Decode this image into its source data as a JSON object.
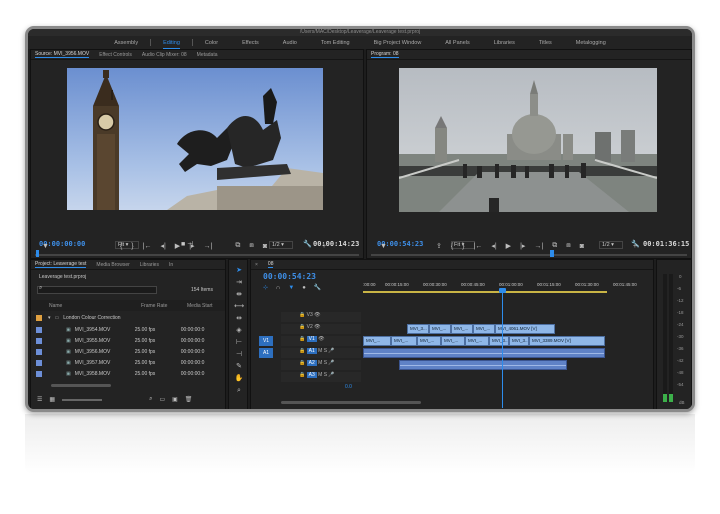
{
  "window": {
    "title": "/Users/MAC/Desktop/Leaverage/Leaverage test.prproj"
  },
  "workspaces": [
    "Assembly",
    "Editing",
    "Color",
    "Effects",
    "Audio",
    "Tom Editing",
    "Big Project Window",
    "All Panels",
    "Libraries",
    "Titles",
    "Metalogging"
  ],
  "active_workspace": "Editing",
  "source": {
    "tabs": [
      "Source: MVI_3956.MOV",
      "Effect Controls",
      "Audio Clip Mixer: 08",
      "Metadata"
    ],
    "timecode": "00:00:00:00",
    "fit": "Fit",
    "resolution": "1/2",
    "duration": "00:00:14:23"
  },
  "program": {
    "tab": "Program: 08",
    "timecode": "00:00:54:23",
    "fit": "Fit",
    "resolution": "1/2",
    "duration": "00:01:36:15"
  },
  "project": {
    "tabs": [
      "Project: Leaverage test",
      "Media Browser",
      "Libraries",
      "In"
    ],
    "file": "Leaverage test.prproj",
    "count": "154 Items",
    "columns": [
      "Name",
      "Frame Rate",
      "Media Start"
    ],
    "folder": "London Colour Correction",
    "items": [
      {
        "name": "MVI_3954.MOV",
        "fps": "25.00 fps",
        "start": "00:00:00:0"
      },
      {
        "name": "MVI_3955.MOV",
        "fps": "25.00 fps",
        "start": "00:00:00:0"
      },
      {
        "name": "MVI_3956.MOV",
        "fps": "25.00 fps",
        "start": "00:00:00:0"
      },
      {
        "name": "MVI_3957.MOV",
        "fps": "25.00 fps",
        "start": "00:00:00:0"
      },
      {
        "name": "MVI_3958.MOV",
        "fps": "25.00 fps",
        "start": "00:00:00:0"
      }
    ]
  },
  "timeline": {
    "tab": "08",
    "timecode": "00:00:54:23",
    "ruler": [
      ":00:00",
      "00:00:15:00",
      "00:00:30:00",
      "00:00:45:00",
      "00:01:00:00",
      "00:01:15:00",
      "00:01:30:00",
      "00:01:45:00"
    ],
    "tracks": {
      "video": [
        "V3",
        "V2",
        "V1"
      ],
      "audio": [
        "A1",
        "A2",
        "A3"
      ],
      "source_video": "V1",
      "source_audio": "A1"
    },
    "v2_clips": [
      "MVI_3...",
      "MVI_...",
      "MVI_...",
      "MVI_...",
      "MVI_4061.MOV [V]"
    ],
    "v1_clips": [
      "MVI_...",
      "MVI_...",
      "MVI_...",
      "MVI_...",
      "MVI_...",
      "MVI_3...",
      "MVI_3...",
      "MVI_3389.MOV [V]"
    ],
    "audio_volume": "0.0"
  },
  "meter": {
    "labels": [
      "0",
      "-6",
      "-12",
      "-18",
      "-24",
      "-30",
      "-36",
      "-42",
      "-48",
      "-54"
    ],
    "bottom_label": "dB"
  },
  "colors": {
    "accent": "#2d8ceb",
    "clip_video": "#8fb7e8",
    "clip_audio": "#5f82c6"
  }
}
